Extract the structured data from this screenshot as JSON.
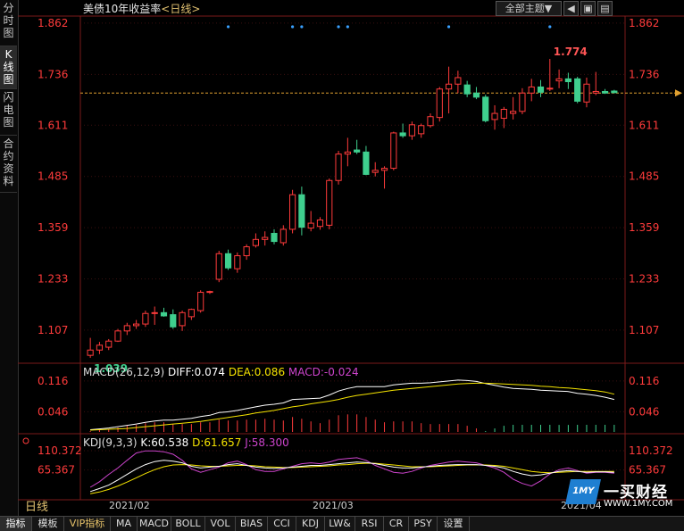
{
  "left_tabs": [
    {
      "label": "分时图",
      "active": false
    },
    {
      "label": "K线图",
      "active": true
    },
    {
      "label": "闪电图",
      "active": false
    },
    {
      "label": "合约资料",
      "active": false
    }
  ],
  "header": {
    "title": "美债10年收益率",
    "period": "<日线>",
    "theme_button": "全部主题▼",
    "tool_buttons": [
      "◀",
      "▣",
      "▤"
    ]
  },
  "colors": {
    "up": "#ff3b3b",
    "down": "#3fcf8e",
    "axis_text": "#ff3b3b",
    "grid": "#3a0f0f",
    "dif_line": "#ffffff",
    "dea_line": "#f5e400",
    "macd_label": "#cc44cc",
    "k_line": "#ffffff",
    "d_line": "#f5e400",
    "j_line": "#cc44cc",
    "last_price_line": "#e0a030"
  },
  "chart_data": {
    "type": "candlestick",
    "title": "美债10年收益率",
    "price_axis_ticks": [
      "1.862",
      "1.736",
      "1.611",
      "1.485",
      "1.359",
      "1.233",
      "1.107"
    ],
    "ylim": [
      1.03,
      1.875
    ],
    "x_labels": [
      "2021/02",
      "2021/03",
      "2021/04"
    ],
    "high_label": "1.774",
    "low_label": "1.039",
    "last_price": 1.69,
    "event_marker_bars": [
      15,
      22,
      23,
      27,
      28,
      39,
      50
    ],
    "candles": [
      {
        "o": 1.045,
        "h": 1.088,
        "l": 1.039,
        "c": 1.058
      },
      {
        "o": 1.058,
        "h": 1.078,
        "l": 1.048,
        "c": 1.07
      },
      {
        "o": 1.065,
        "h": 1.085,
        "l": 1.058,
        "c": 1.08
      },
      {
        "o": 1.08,
        "h": 1.11,
        "l": 1.078,
        "c": 1.105
      },
      {
        "o": 1.105,
        "h": 1.125,
        "l": 1.095,
        "c": 1.118
      },
      {
        "o": 1.118,
        "h": 1.132,
        "l": 1.11,
        "c": 1.122
      },
      {
        "o": 1.122,
        "h": 1.155,
        "l": 1.115,
        "c": 1.148
      },
      {
        "o": 1.148,
        "h": 1.165,
        "l": 1.12,
        "c": 1.15
      },
      {
        "o": 1.15,
        "h": 1.162,
        "l": 1.14,
        "c": 1.142
      },
      {
        "o": 1.145,
        "h": 1.158,
        "l": 1.11,
        "c": 1.115
      },
      {
        "o": 1.118,
        "h": 1.155,
        "l": 1.105,
        "c": 1.15
      },
      {
        "o": 1.14,
        "h": 1.16,
        "l": 1.132,
        "c": 1.158
      },
      {
        "o": 1.155,
        "h": 1.205,
        "l": 1.15,
        "c": 1.2
      },
      {
        "o": 1.2,
        "h": 1.204,
        "l": 1.196,
        "c": 1.202
      },
      {
        "o": 1.232,
        "h": 1.302,
        "l": 1.225,
        "c": 1.295
      },
      {
        "o": 1.295,
        "h": 1.305,
        "l": 1.255,
        "c": 1.26
      },
      {
        "o": 1.258,
        "h": 1.298,
        "l": 1.248,
        "c": 1.29
      },
      {
        "o": 1.29,
        "h": 1.318,
        "l": 1.28,
        "c": 1.312
      },
      {
        "o": 1.315,
        "h": 1.345,
        "l": 1.31,
        "c": 1.33
      },
      {
        "o": 1.33,
        "h": 1.35,
        "l": 1.315,
        "c": 1.335
      },
      {
        "o": 1.345,
        "h": 1.355,
        "l": 1.318,
        "c": 1.325
      },
      {
        "o": 1.322,
        "h": 1.365,
        "l": 1.315,
        "c": 1.355
      },
      {
        "o": 1.355,
        "h": 1.452,
        "l": 1.345,
        "c": 1.44
      },
      {
        "o": 1.44,
        "h": 1.46,
        "l": 1.34,
        "c": 1.36
      },
      {
        "o": 1.358,
        "h": 1.4,
        "l": 1.35,
        "c": 1.37
      },
      {
        "o": 1.362,
        "h": 1.385,
        "l": 1.354,
        "c": 1.378
      },
      {
        "o": 1.365,
        "h": 1.48,
        "l": 1.355,
        "c": 1.475
      },
      {
        "o": 1.475,
        "h": 1.548,
        "l": 1.465,
        "c": 1.54
      },
      {
        "o": 1.54,
        "h": 1.58,
        "l": 1.51,
        "c": 1.545
      },
      {
        "o": 1.55,
        "h": 1.575,
        "l": 1.54,
        "c": 1.545
      },
      {
        "o": 1.545,
        "h": 1.56,
        "l": 1.488,
        "c": 1.49
      },
      {
        "o": 1.495,
        "h": 1.52,
        "l": 1.485,
        "c": 1.5
      },
      {
        "o": 1.5,
        "h": 1.51,
        "l": 1.455,
        "c": 1.505
      },
      {
        "o": 1.505,
        "h": 1.595,
        "l": 1.5,
        "c": 1.592
      },
      {
        "o": 1.592,
        "h": 1.615,
        "l": 1.58,
        "c": 1.585
      },
      {
        "o": 1.585,
        "h": 1.62,
        "l": 1.575,
        "c": 1.612
      },
      {
        "o": 1.59,
        "h": 1.615,
        "l": 1.58,
        "c": 1.61
      },
      {
        "o": 1.61,
        "h": 1.64,
        "l": 1.605,
        "c": 1.632
      },
      {
        "o": 1.63,
        "h": 1.705,
        "l": 1.62,
        "c": 1.7
      },
      {
        "o": 1.7,
        "h": 1.755,
        "l": 1.64,
        "c": 1.712
      },
      {
        "o": 1.712,
        "h": 1.745,
        "l": 1.69,
        "c": 1.728
      },
      {
        "o": 1.71,
        "h": 1.72,
        "l": 1.68,
        "c": 1.688
      },
      {
        "o": 1.69,
        "h": 1.705,
        "l": 1.675,
        "c": 1.68
      },
      {
        "o": 1.68,
        "h": 1.686,
        "l": 1.618,
        "c": 1.622
      },
      {
        "o": 1.625,
        "h": 1.66,
        "l": 1.6,
        "c": 1.64
      },
      {
        "o": 1.628,
        "h": 1.656,
        "l": 1.604,
        "c": 1.65
      },
      {
        "o": 1.64,
        "h": 1.68,
        "l": 1.625,
        "c": 1.645
      },
      {
        "o": 1.645,
        "h": 1.702,
        "l": 1.638,
        "c": 1.69
      },
      {
        "o": 1.69,
        "h": 1.725,
        "l": 1.67,
        "c": 1.705
      },
      {
        "o": 1.705,
        "h": 1.722,
        "l": 1.68,
        "c": 1.692
      },
      {
        "o": 1.7,
        "h": 1.774,
        "l": 1.695,
        "c": 1.702
      },
      {
        "o": 1.72,
        "h": 1.748,
        "l": 1.702,
        "c": 1.725
      },
      {
        "o": 1.725,
        "h": 1.74,
        "l": 1.7,
        "c": 1.718
      },
      {
        "o": 1.725,
        "h": 1.73,
        "l": 1.665,
        "c": 1.67
      },
      {
        "o": 1.668,
        "h": 1.728,
        "l": 1.655,
        "c": 1.712
      },
      {
        "o": 1.69,
        "h": 1.742,
        "l": 1.685,
        "c": 1.694
      },
      {
        "o": 1.694,
        "h": 1.7,
        "l": 1.688,
        "c": 1.69
      },
      {
        "o": 1.695,
        "h": 1.698,
        "l": 1.69,
        "c": 1.691
      }
    ],
    "macd": {
      "label": "MACD(26,12,9)",
      "dif_label": "DIFF:0.074",
      "dea_label": "DEA:0.086",
      "macd_label": "MACD:-0.024",
      "ticks": [
        "0.116",
        "0.046"
      ],
      "ylim": [
        0.0,
        0.13
      ],
      "dif": [
        0.005,
        0.007,
        0.009,
        0.012,
        0.015,
        0.018,
        0.022,
        0.025,
        0.027,
        0.027,
        0.029,
        0.031,
        0.035,
        0.038,
        0.044,
        0.046,
        0.049,
        0.053,
        0.057,
        0.061,
        0.063,
        0.066,
        0.074,
        0.075,
        0.076,
        0.077,
        0.084,
        0.093,
        0.099,
        0.103,
        0.103,
        0.103,
        0.103,
        0.107,
        0.109,
        0.111,
        0.111,
        0.112,
        0.114,
        0.116,
        0.118,
        0.117,
        0.115,
        0.11,
        0.106,
        0.102,
        0.099,
        0.098,
        0.097,
        0.095,
        0.094,
        0.093,
        0.092,
        0.088,
        0.086,
        0.083,
        0.079,
        0.074
      ],
      "dea": [
        0.004,
        0.005,
        0.006,
        0.007,
        0.008,
        0.01,
        0.012,
        0.014,
        0.016,
        0.018,
        0.02,
        0.022,
        0.024,
        0.027,
        0.03,
        0.033,
        0.036,
        0.039,
        0.043,
        0.046,
        0.049,
        0.053,
        0.057,
        0.06,
        0.064,
        0.067,
        0.07,
        0.074,
        0.079,
        0.083,
        0.086,
        0.089,
        0.092,
        0.095,
        0.097,
        0.099,
        0.101,
        0.103,
        0.105,
        0.107,
        0.109,
        0.11,
        0.111,
        0.111,
        0.11,
        0.109,
        0.108,
        0.107,
        0.106,
        0.104,
        0.103,
        0.101,
        0.1,
        0.098,
        0.096,
        0.094,
        0.091,
        0.086
      ],
      "hist": [
        0.002,
        0.004,
        0.006,
        0.01,
        0.014,
        0.016,
        0.02,
        0.022,
        0.022,
        0.018,
        0.018,
        0.018,
        0.022,
        0.022,
        0.028,
        0.026,
        0.026,
        0.028,
        0.028,
        0.03,
        0.028,
        0.026,
        0.034,
        0.03,
        0.024,
        0.02,
        0.028,
        0.038,
        0.04,
        0.04,
        0.034,
        0.028,
        0.022,
        0.024,
        0.024,
        0.024,
        0.02,
        0.018,
        0.018,
        0.018,
        0.018,
        0.014,
        0.008,
        -0.002,
        -0.008,
        -0.014,
        -0.018,
        -0.018,
        -0.018,
        -0.018,
        -0.018,
        -0.016,
        -0.016,
        -0.02,
        -0.02,
        -0.022,
        -0.024,
        -0.024
      ]
    },
    "kdj": {
      "label": "KDJ(9,3,3)",
      "k_label": "K:60.538",
      "d_label": "D:61.657",
      "j_label": "J:58.300",
      "ticks": [
        "110.372",
        "65.367"
      ],
      "ylim": [
        0,
        125
      ],
      "k": [
        15,
        22,
        30,
        42,
        55,
        68,
        78,
        85,
        88,
        86,
        82,
        74,
        70,
        72,
        74,
        78,
        80,
        76,
        72,
        70,
        69,
        70,
        72,
        74,
        76,
        76,
        78,
        80,
        82,
        84,
        83,
        80,
        76,
        72,
        70,
        70,
        72,
        74,
        76,
        77,
        78,
        78,
        78,
        76,
        74,
        70,
        62,
        56,
        52,
        54,
        58,
        62,
        64,
        62,
        60,
        61,
        61,
        60
      ],
      "d": [
        10,
        14,
        20,
        28,
        37,
        47,
        57,
        66,
        73,
        77,
        78,
        77,
        75,
        74,
        74,
        75,
        76,
        76,
        75,
        73,
        72,
        71,
        71,
        72,
        73,
        74,
        75,
        77,
        78,
        80,
        81,
        81,
        79,
        77,
        75,
        73,
        73,
        73,
        74,
        75,
        76,
        77,
        77,
        77,
        76,
        74,
        70,
        66,
        62,
        60,
        59,
        60,
        61,
        62,
        62,
        62,
        62,
        62
      ],
      "j": [
        25,
        38,
        55,
        70,
        88,
        105,
        110,
        110,
        108,
        102,
        88,
        68,
        60,
        66,
        72,
        82,
        86,
        78,
        66,
        62,
        62,
        68,
        74,
        80,
        82,
        80,
        84,
        90,
        92,
        94,
        88,
        76,
        68,
        60,
        58,
        62,
        70,
        76,
        80,
        84,
        86,
        84,
        82,
        76,
        70,
        60,
        44,
        34,
        28,
        40,
        56,
        66,
        70,
        64,
        58,
        60,
        60,
        58
      ]
    }
  },
  "period_label": "日线",
  "bottom_tabs": [
    {
      "label": "指标",
      "active": true
    },
    {
      "label": "模板"
    },
    {
      "label": "VIP指标",
      "vip": true
    },
    {
      "label": "MA"
    },
    {
      "label": "MACD"
    },
    {
      "label": "BOLL"
    },
    {
      "label": "VOL"
    },
    {
      "label": "BIAS"
    },
    {
      "label": "CCI"
    },
    {
      "label": "KDJ"
    },
    {
      "label": "LW&"
    },
    {
      "label": "RSI"
    },
    {
      "label": "CR"
    },
    {
      "label": "PSY"
    },
    {
      "label": "设置"
    }
  ],
  "logo": {
    "badge": "1MY",
    "name": "一买财经",
    "url": "WWW.1MY.COM"
  }
}
